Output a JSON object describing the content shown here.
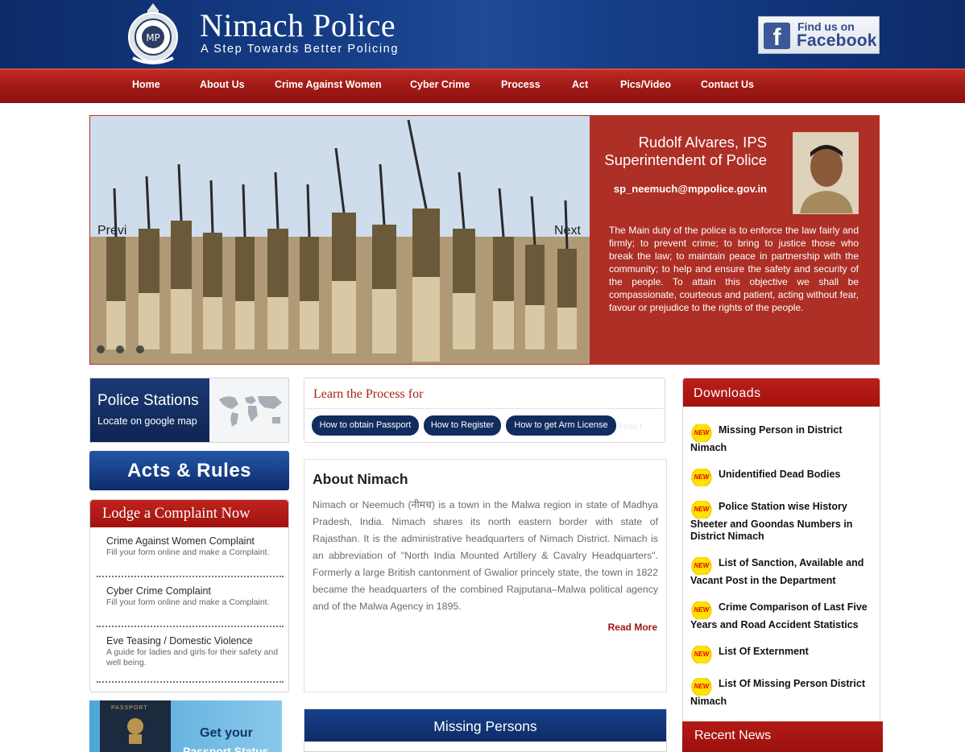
{
  "header": {
    "title": "Nimach Police",
    "tagline": "A Step Towards Better Policing",
    "facebook": {
      "line1": "Find us on",
      "line2": "Facebook"
    }
  },
  "nav": [
    {
      "label": "Home",
      "name": "nav-home"
    },
    {
      "label": "About Us",
      "name": "nav-about-us"
    },
    {
      "label": "Crime Against Women",
      "name": "nav-crime-against-women"
    },
    {
      "label": "Cyber Crime",
      "name": "nav-cyber-crime"
    },
    {
      "label": "Process",
      "name": "nav-process"
    },
    {
      "label": "Act",
      "name": "nav-act"
    },
    {
      "label": "Pics/Video",
      "name": "nav-pics-video"
    },
    {
      "label": "Contact Us",
      "name": "nav-contact-us"
    }
  ],
  "slider": {
    "prev_label": "Previ",
    "next_label": "Next",
    "sp_name": "Rudolf Alvares, IPS",
    "sp_title": "Superintendent of Police",
    "sp_email": "sp_neemuch@mppolice.gov.in",
    "sp_text": "The Main duty of the police is to enforce the law fairly and firmly; to prevent crime; to bring to justice those who break the law; to maintain peace in partnership with the community; to help and ensure the safety and security of the people. To attain this objective we shall be compassionate, courteous and patient, acting without fear, favour or prejudice to the rights of the people."
  },
  "police_stations": {
    "title": "Police Stations",
    "subtitle": "Locate on google map"
  },
  "acts_rules": {
    "label": "Acts & Rules"
  },
  "lodge": {
    "title": "Lodge a Complaint Now",
    "items": [
      {
        "title": "Crime Against Women Complaint",
        "desc": "Fill your form online and make a Complaint."
      },
      {
        "title": "Cyber Crime Complaint",
        "desc": "Fill your form online and make a Complaint."
      },
      {
        "title": "Eve Teasing / Domestic Violence",
        "desc": "A guide for ladies and girls for their safety and well being."
      }
    ]
  },
  "passport_banner": {
    "book_label": "PASSPORT",
    "line1": "Get your",
    "line2": "Passport Status"
  },
  "process": {
    "title": "Learn the Process for",
    "buttons": [
      "How to obtain Passport",
      "How to Register",
      "How to get Arm License"
    ],
    "ghost": "How t"
  },
  "about": {
    "title": "About Nimach",
    "text": "Nimach or Neemuch (नीमच) is a town in the Malwa region in state of Madhya Pradesh, India. Nimach shares its north eastern border with state of Rajasthan. It is the administrative headquarters of Nimach District. Nimach is an abbreviation of \"North India Mounted Artillery & Cavalry Headquarters\". Formerly a large British cantonment of Gwalior princely state, the town in 1822 became the headquarters of the combined Rajputana–Malwa political agency and of the Malwa Agency in 1895.",
    "read_more": "Read More"
  },
  "missing": {
    "title": "Missing Persons"
  },
  "downloads": {
    "title": "Downloads",
    "badge": "NEW",
    "items": [
      "Missing Person in District Nimach",
      "Unidentified Dead Bodies",
      "Police Station wise History Sheeter and Goondas Numbers in District Nimach",
      "List of Sanction, Available and Vacant Post in the Department",
      "Crime Comparison of Last Five Years and Road Accident Statistics",
      "List Of Externment",
      "List Of Missing Person District Nimach"
    ]
  },
  "recent_news": {
    "title": "Recent News"
  },
  "colors": {
    "nav_red": "#a11a16",
    "header_blue": "#163d86",
    "accent_red": "#a32117",
    "button_navy": "#102d5e"
  }
}
